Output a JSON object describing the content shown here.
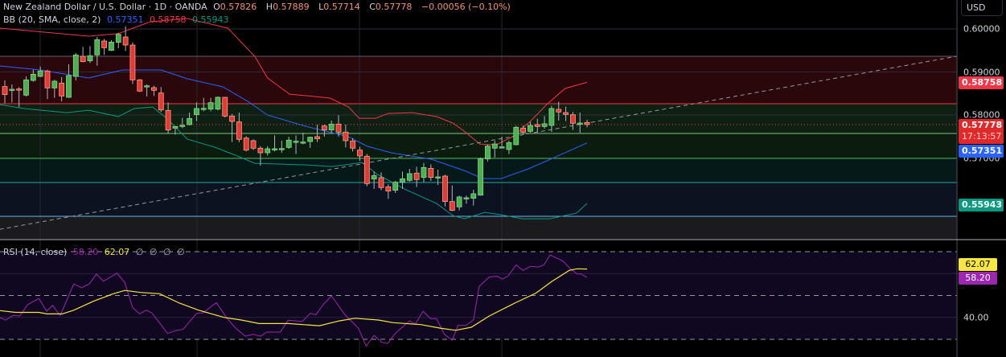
{
  "header": {
    "title": "New Zealand Dollar / U.S. Dollar · 1D · OANDA",
    "o_label": "O",
    "o": "0.57826",
    "h_label": "H",
    "h": "0.57889",
    "l_label": "L",
    "l": "0.57714",
    "c_label": "C",
    "c": "0.57778",
    "change": "−0.00056 (−0.10%)"
  },
  "bb_legend": {
    "label": "BB (20, SMA, close, 2)",
    "basis": "0.57351",
    "upper": "0.58758",
    "lower": "0.55943"
  },
  "rsi_legend": {
    "label": "RSI (14, close)",
    "rsi": "58.20",
    "ma": "62.07",
    "extras": [
      "∅",
      "∅",
      "∅",
      "∅"
    ]
  },
  "axis": {
    "currency": "USD",
    "price_ticks": [
      "0.60000",
      "0.59000",
      "0.58000",
      "0.57000"
    ],
    "rsi_ticks": [
      "40.00"
    ]
  },
  "badges": {
    "upper": "0.58758",
    "last": "0.57778",
    "countdown": "17:13:57",
    "basis": "0.57351",
    "lower": "0.55943",
    "rsi_ma": "62.07",
    "rsi": "58.20"
  },
  "colors": {
    "up": "#4caf50",
    "down": "#e53935",
    "bb_upper": "#f23645",
    "bb_basis": "#2962ff",
    "bb_lower": "#089981",
    "rsi": "#9c27b0",
    "rsi_ma": "#f5e642"
  },
  "chart_data": {
    "type": "candlestick",
    "title": "New Zealand Dollar / U.S. Dollar · 1D · OANDA",
    "ylim": [
      0.5525,
      0.6015
    ],
    "ohlc": [
      [
        0.58661,
        0.58804,
        0.58274,
        0.58474
      ],
      [
        0.5859,
        0.5871,
        0.58293,
        0.58598
      ],
      [
        0.58605,
        0.58648,
        0.58181,
        0.58598
      ],
      [
        0.58461,
        0.58897,
        0.5843,
        0.58816
      ],
      [
        0.58804,
        0.59053,
        0.58773,
        0.58947
      ],
      [
        0.58897,
        0.59128,
        0.58879,
        0.59022
      ],
      [
        0.59022,
        0.59053,
        0.58368,
        0.58629
      ],
      [
        0.58629,
        0.58816,
        0.58399,
        0.58785
      ],
      [
        0.58741,
        0.58879,
        0.58318,
        0.58442
      ],
      [
        0.58411,
        0.59178,
        0.58399,
        0.58916
      ],
      [
        0.58897,
        0.59439,
        0.58804,
        0.59396
      ],
      [
        0.59364,
        0.59583,
        0.59227,
        0.5924
      ],
      [
        0.59259,
        0.59601,
        0.59209,
        0.59377
      ],
      [
        0.59396,
        0.59813,
        0.59146,
        0.59751
      ],
      [
        0.5972,
        0.59769,
        0.59396,
        0.59564
      ],
      [
        0.59502,
        0.59738,
        0.59489,
        0.59695
      ],
      [
        0.59688,
        0.59913,
        0.59551,
        0.59875
      ],
      [
        0.59813,
        0.60062,
        0.59489,
        0.59626
      ],
      [
        0.59626,
        0.59688,
        0.58723,
        0.58816
      ],
      [
        0.58816,
        0.58835,
        0.58536,
        0.58555
      ],
      [
        0.58675,
        0.5871,
        0.5843,
        0.58679
      ],
      [
        0.58636,
        0.58679,
        0.58442,
        0.58573
      ],
      [
        0.58511,
        0.58648,
        0.58069,
        0.58118
      ],
      [
        0.58106,
        0.58293,
        0.57576,
        0.57651
      ],
      [
        0.57695,
        0.57745,
        0.57545,
        0.57732
      ],
      [
        0.57755,
        0.57932,
        0.57695,
        0.5776
      ],
      [
        0.57776,
        0.58056,
        0.57757,
        0.57919
      ],
      [
        0.58006,
        0.58293,
        0.57857,
        0.5815
      ],
      [
        0.5815,
        0.58399,
        0.58087,
        0.58155
      ],
      [
        0.58137,
        0.58399,
        0.58087,
        0.58287
      ],
      [
        0.58137,
        0.5843,
        0.58106,
        0.58411
      ],
      [
        0.58411,
        0.58411,
        0.57944,
        0.57975
      ],
      [
        0.57975,
        0.58025,
        0.57371,
        0.57851
      ],
      [
        0.57838,
        0.58056,
        0.57371,
        0.57433
      ],
      [
        0.57464,
        0.57508,
        0.57153,
        0.57184
      ],
      [
        0.57402,
        0.57433,
        0.57184,
        0.57228
      ],
      [
        0.57228,
        0.57277,
        0.56823,
        0.57122
      ],
      [
        0.57122,
        0.57277,
        0.57059,
        0.57215
      ],
      [
        0.5721,
        0.57527,
        0.57153,
        0.57215
      ],
      [
        0.57215,
        0.57402,
        0.57122,
        0.5722
      ],
      [
        0.57246,
        0.57495,
        0.57215,
        0.57415
      ],
      [
        0.57385,
        0.57527,
        0.57091,
        0.5739
      ],
      [
        0.57365,
        0.57589,
        0.57321,
        0.57371
      ],
      [
        0.57383,
        0.57496,
        0.57234,
        0.57483
      ],
      [
        0.57496,
        0.57776,
        0.57371,
        0.57446
      ],
      [
        0.57745,
        0.57776,
        0.57496,
        0.57651
      ],
      [
        0.57651,
        0.57869,
        0.57589,
        0.57788
      ],
      [
        0.57788,
        0.57994,
        0.57496,
        0.57602
      ],
      [
        0.57602,
        0.57776,
        0.57246,
        0.57402
      ],
      [
        0.57396,
        0.57464,
        0.57153,
        0.57228
      ],
      [
        0.57184,
        0.57259,
        0.56935,
        0.57047
      ],
      [
        0.57041,
        0.57091,
        0.56343,
        0.56405
      ],
      [
        0.56511,
        0.56686,
        0.56281,
        0.56592
      ],
      [
        0.56542,
        0.56667,
        0.5625,
        0.56312
      ],
      [
        0.56331,
        0.56387,
        0.5605,
        0.56231
      ],
      [
        0.5625,
        0.56468,
        0.56187,
        0.56436
      ],
      [
        0.56436,
        0.56686,
        0.56281,
        0.56517
      ],
      [
        0.5648,
        0.56748,
        0.56449,
        0.56636
      ],
      [
        0.56648,
        0.56798,
        0.56324,
        0.56499
      ],
      [
        0.56549,
        0.56885,
        0.56436,
        0.56779
      ],
      [
        0.5676,
        0.56854,
        0.56468,
        0.56549
      ],
      [
        0.56556,
        0.56729,
        0.56374,
        0.56561
      ],
      [
        0.5658,
        0.56611,
        0.55876,
        0.55988
      ],
      [
        0.55988,
        0.56362,
        0.55764,
        0.55782
      ],
      [
        0.55863,
        0.56125,
        0.55782,
        0.56094
      ],
      [
        0.5607,
        0.56125,
        0.55938,
        0.56075
      ],
      [
        0.56063,
        0.56262,
        0.55894,
        0.56169
      ],
      [
        0.56137,
        0.5701,
        0.56125,
        0.56979
      ],
      [
        0.56979,
        0.57309,
        0.56922,
        0.57278
      ],
      [
        0.57228,
        0.57402,
        0.5701,
        0.57327
      ],
      [
        0.57254,
        0.57496,
        0.57234,
        0.57259
      ],
      [
        0.57197,
        0.57402,
        0.57091,
        0.57358
      ],
      [
        0.57309,
        0.57745,
        0.57296,
        0.57714
      ],
      [
        0.57695,
        0.57757,
        0.57558,
        0.57602
      ],
      [
        0.5762,
        0.57838,
        0.57589,
        0.57757
      ],
      [
        0.57776,
        0.57913,
        0.57589,
        0.57732
      ],
      [
        0.57732,
        0.57975,
        0.57682,
        0.57795
      ],
      [
        0.57757,
        0.58212,
        0.57608,
        0.5815
      ],
      [
        0.58131,
        0.58306,
        0.57869,
        0.58069
      ],
      [
        0.58056,
        0.58193,
        0.57857,
        0.58012
      ],
      [
        0.58006,
        0.58069,
        0.57651,
        0.57807
      ],
      [
        0.57807,
        0.58056,
        0.57589,
        0.57812
      ],
      [
        0.57826,
        0.57889,
        0.57714,
        0.57778
      ]
    ],
    "bollinger": {
      "upper": [
        [
          -0.7,
          0.60019
        ],
        [
          11.8,
          0.59832
        ],
        [
          16,
          0.59893
        ],
        [
          20.5,
          0.60168
        ],
        [
          25.7,
          0.60243
        ],
        [
          31.4,
          0.60019
        ],
        [
          35.2,
          0.59364
        ],
        [
          37,
          0.58859
        ],
        [
          40.1,
          0.58485
        ],
        [
          42.4,
          0.58448
        ],
        [
          45.8,
          0.58392
        ],
        [
          48.4,
          0.58186
        ],
        [
          49.9,
          0.57924
        ],
        [
          52.2,
          0.57924
        ],
        [
          54,
          0.58036
        ],
        [
          57.4,
          0.58055
        ],
        [
          60.8,
          0.57962
        ],
        [
          63.1,
          0.57812
        ],
        [
          64.7,
          0.57625
        ],
        [
          66.9,
          0.57326
        ],
        [
          69.2,
          0.57307
        ],
        [
          71.5,
          0.57494
        ],
        [
          74.1,
          0.57868
        ],
        [
          76.3,
          0.58242
        ],
        [
          78.9,
          0.58616
        ],
        [
          82,
          0.58758
        ]
      ],
      "basis": [
        [
          -0.7,
          0.5914
        ],
        [
          5,
          0.59046
        ],
        [
          11.8,
          0.58859
        ],
        [
          16.6,
          0.59046
        ],
        [
          22,
          0.59046
        ],
        [
          25.7,
          0.58841
        ],
        [
          30.7,
          0.58654
        ],
        [
          34.4,
          0.58298
        ],
        [
          37,
          0.57999
        ],
        [
          42.4,
          0.57737
        ],
        [
          48.4,
          0.57494
        ],
        [
          51.1,
          0.5727
        ],
        [
          54.5,
          0.5712
        ],
        [
          60.1,
          0.56971
        ],
        [
          64.7,
          0.56709
        ],
        [
          67.3,
          0.56522
        ],
        [
          69.9,
          0.56522
        ],
        [
          73.7,
          0.56746
        ],
        [
          77.1,
          0.56989
        ],
        [
          82,
          0.57351
        ]
      ],
      "lower": [
        [
          -0.7,
          0.58242
        ],
        [
          2.7,
          0.58149
        ],
        [
          8.7,
          0.58055
        ],
        [
          11.8,
          0.58111
        ],
        [
          16,
          0.57962
        ],
        [
          18.2,
          0.58149
        ],
        [
          20.8,
          0.58186
        ],
        [
          22.8,
          0.57924
        ],
        [
          25.7,
          0.57438
        ],
        [
          29.6,
          0.57251
        ],
        [
          32.5,
          0.57064
        ],
        [
          35.2,
          0.56877
        ],
        [
          42.4,
          0.5684
        ],
        [
          46.1,
          0.56802
        ],
        [
          50.3,
          0.56896
        ],
        [
          52.5,
          0.56615
        ],
        [
          56.3,
          0.56279
        ],
        [
          60.8,
          0.55942
        ],
        [
          63.1,
          0.55662
        ],
        [
          64.7,
          0.55587
        ],
        [
          67.6,
          0.55736
        ],
        [
          69.9,
          0.5568
        ],
        [
          72.9,
          0.55587
        ],
        [
          76.7,
          0.55587
        ],
        [
          80.5,
          0.55718
        ],
        [
          82,
          0.55943
        ]
      ]
    },
    "fib_levels": [
      0.59364,
      0.58261,
      0.5757,
      0.56991,
      0.5643,
      0.55645
    ],
    "trendline": [
      [
        -0.7,
        0.55342
      ],
      [
        134,
        0.59364
      ]
    ],
    "last_price": 0.57778,
    "price_gridlines": [
      0.6,
      0.59,
      0.58,
      0.57
    ],
    "rsi": {
      "levels": {
        "upper": 70,
        "middle": 50,
        "lower": 30
      },
      "gridlines": [
        60,
        40
      ],
      "rsi": [
        [
          -0.7,
          40.0
        ],
        [
          0.1,
          38.8
        ],
        [
          1.2,
          40.9
        ],
        [
          2.1,
          40.6
        ],
        [
          3.2,
          45.8
        ],
        [
          4.8,
          48.6
        ],
        [
          5.9,
          42.8
        ],
        [
          6.7,
          45.5
        ],
        [
          7.8,
          40.9
        ],
        [
          9.7,
          55.3
        ],
        [
          10.8,
          53.5
        ],
        [
          11.9,
          55.3
        ],
        [
          12.9,
          59.8
        ],
        [
          13.9,
          56.5
        ],
        [
          15.8,
          60.2
        ],
        [
          16.9,
          55.9
        ],
        [
          18,
          44.5
        ],
        [
          19,
          41.6
        ],
        [
          19.9,
          43.3
        ],
        [
          20.7,
          42.1
        ],
        [
          22.9,
          32.7
        ],
        [
          24.3,
          34.2
        ],
        [
          25.1,
          34.5
        ],
        [
          27,
          41.8
        ],
        [
          27.9,
          42.1
        ],
        [
          29.8,
          46.7
        ],
        [
          31.2,
          40.0
        ],
        [
          32.5,
          35.1
        ],
        [
          33.9,
          31.4
        ],
        [
          35,
          32.3
        ],
        [
          36,
          31.4
        ],
        [
          36.9,
          33.3
        ],
        [
          38.8,
          33.3
        ],
        [
          39.9,
          38.7
        ],
        [
          41.9,
          38.2
        ],
        [
          43,
          41.8
        ],
        [
          43.8,
          41.2
        ],
        [
          44.9,
          46.1
        ],
        [
          46,
          49.8
        ],
        [
          47.9,
          41.2
        ],
        [
          49.8,
          35.1
        ],
        [
          50.9,
          26.9
        ],
        [
          52,
          31.8
        ],
        [
          53.1,
          28.6
        ],
        [
          53.9,
          28.1
        ],
        [
          55,
          32.7
        ],
        [
          57,
          38.4
        ],
        [
          57.8,
          36.9
        ],
        [
          58.9,
          42.8
        ],
        [
          60,
          39.4
        ],
        [
          60.8,
          39.4
        ],
        [
          61.9,
          32.3
        ],
        [
          63,
          29.6
        ],
        [
          63.8,
          36.3
        ],
        [
          64.9,
          36.3
        ],
        [
          66,
          38.8
        ],
        [
          66.8,
          54.1
        ],
        [
          68.2,
          58.4
        ],
        [
          69.3,
          58.8
        ],
        [
          70.1,
          57.5
        ],
        [
          70.9,
          59.0
        ],
        [
          72,
          63.9
        ],
        [
          73,
          61.4
        ],
        [
          74,
          63.3
        ],
        [
          75.1,
          63.0
        ],
        [
          75.9,
          63.9
        ],
        [
          76.8,
          68.5
        ],
        [
          78.6,
          65.7
        ],
        [
          79.7,
          62.0
        ],
        [
          80.6,
          59.8
        ],
        [
          81.1,
          59.9
        ],
        [
          82,
          58.2
        ]
      ],
      "ma": [
        [
          -0.7,
          43.1
        ],
        [
          1.5,
          42.3
        ],
        [
          4.8,
          42.3
        ],
        [
          5.9,
          41.6
        ],
        [
          8.1,
          41.6
        ],
        [
          9.7,
          43.3
        ],
        [
          12.5,
          47.4
        ],
        [
          15.2,
          50.7
        ],
        [
          16.9,
          52.3
        ],
        [
          19.1,
          51.4
        ],
        [
          21.8,
          50.8
        ],
        [
          24.6,
          46.5
        ],
        [
          27.3,
          43.3
        ],
        [
          30.9,
          40.0
        ],
        [
          33.3,
          38.8
        ],
        [
          35.8,
          37.2
        ],
        [
          39.9,
          37.2
        ],
        [
          44.3,
          36.2
        ],
        [
          47.1,
          38.4
        ],
        [
          49.3,
          39.6
        ],
        [
          52.6,
          38.8
        ],
        [
          54.7,
          37.6
        ],
        [
          58.6,
          36.7
        ],
        [
          61.3,
          35.1
        ],
        [
          63.5,
          34.1
        ],
        [
          65.7,
          35.5
        ],
        [
          68.2,
          40.6
        ],
        [
          71.8,
          46.5
        ],
        [
          74.8,
          51.1
        ],
        [
          77,
          56.3
        ],
        [
          79.5,
          61.5
        ],
        [
          80.6,
          62.2
        ],
        [
          82,
          62.07
        ]
      ]
    }
  }
}
